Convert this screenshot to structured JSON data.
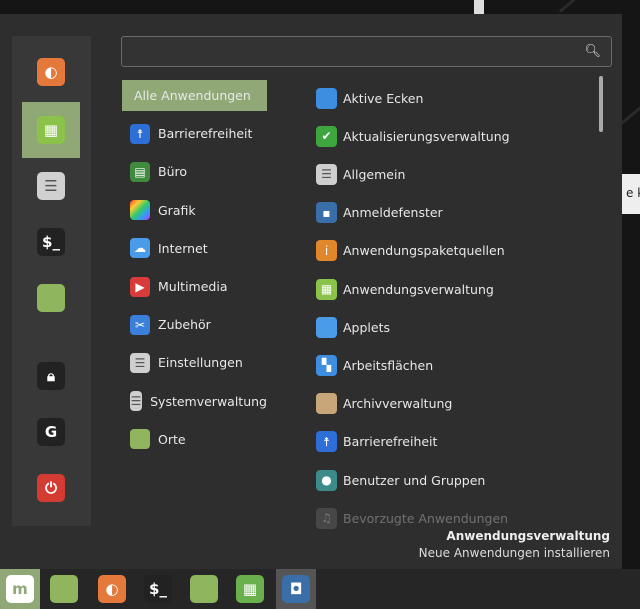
{
  "search": {
    "placeholder": "",
    "value": ""
  },
  "desktop_popup_text": "e ko",
  "sidebar": [
    {
      "name": "firefox",
      "icon": "firefox-icon",
      "color": "#e5793b"
    },
    {
      "name": "software-manager",
      "icon": "mint-install-icon",
      "color": "#8bc34a",
      "selected": true
    },
    {
      "name": "settings",
      "icon": "toggle-settings-icon",
      "color": "#d0d0d0"
    },
    {
      "name": "terminal",
      "icon": "terminal-icon",
      "color": "#222222"
    },
    {
      "name": "files",
      "icon": "folder-icon",
      "color": "#8fb55e"
    },
    {
      "name": "lock",
      "icon": "lock-icon",
      "color": "#222222"
    },
    {
      "name": "logout",
      "icon": "logout-icon",
      "color": "#222222"
    },
    {
      "name": "shutdown",
      "icon": "power-icon",
      "color": "#d43c33"
    }
  ],
  "categories": [
    {
      "label": "Alle Anwendungen",
      "selected": true
    },
    {
      "label": "Barrierefreiheit",
      "icon": "accessibility-icon",
      "color": "#2d6fd6"
    },
    {
      "label": "Büro",
      "icon": "office-icon",
      "color": "#3f8a3f"
    },
    {
      "label": "Grafik",
      "icon": "graphics-icon",
      "color": "#c94bd0"
    },
    {
      "label": "Internet",
      "icon": "cloud-icon",
      "color": "#4a9be8"
    },
    {
      "label": "Multimedia",
      "icon": "play-icon",
      "color": "#d93a3a"
    },
    {
      "label": "Zubehör",
      "icon": "scissors-icon",
      "color": "#3a7fd9"
    },
    {
      "label": "Einstellungen",
      "icon": "settings-icon",
      "color": "#cfcfcf"
    },
    {
      "label": "Systemverwaltung",
      "icon": "system-icon",
      "color": "#cfcfcf"
    },
    {
      "label": "Orte",
      "icon": "folder-icon",
      "color": "#8fb55e"
    }
  ],
  "apps": [
    {
      "label": "Aktive Ecken",
      "icon": "hot-corners-icon",
      "color": "#3d8ee0"
    },
    {
      "label": "Aktualisierungsverwaltung",
      "icon": "shield-icon",
      "color": "#3fa63f"
    },
    {
      "label": "Allgemein",
      "icon": "toggle-icon",
      "color": "#cfcfcf"
    },
    {
      "label": "Anmeldefenster",
      "icon": "login-window-icon",
      "color": "#3a6ea8"
    },
    {
      "label": "Anwendungspaketquellen",
      "icon": "info-icon",
      "color": "#e0862b"
    },
    {
      "label": "Anwendungsverwaltung",
      "icon": "mint-install-icon",
      "color": "#8bc34a"
    },
    {
      "label": "Applets",
      "icon": "applets-icon",
      "color": "#4a9be8"
    },
    {
      "label": "Arbeitsflächen",
      "icon": "workspaces-icon",
      "color": "#3d8ee0"
    },
    {
      "label": "Archivverwaltung",
      "icon": "archive-icon",
      "color": "#c9a67a"
    },
    {
      "label": "Barrierefreiheit",
      "icon": "accessibility-icon",
      "color": "#2d6fd6"
    },
    {
      "label": "Benutzer und Gruppen",
      "icon": "users-icon",
      "color": "#3d8a8a"
    },
    {
      "label": "Bevorzugte Anwendungen",
      "icon": "preferred-apps-icon",
      "color": "#777777",
      "faded": true
    }
  ],
  "description": {
    "title": "Anwendungsverwaltung",
    "subtitle": "Neue Anwendungen installieren"
  },
  "taskbar": [
    {
      "name": "menu",
      "icon": "mint-logo-icon",
      "color": "#8fa876",
      "active": true
    },
    {
      "name": "show-desktop",
      "icon": "desktop-icon",
      "color": "#8fb55e"
    },
    {
      "name": "firefox",
      "icon": "firefox-icon",
      "color": "#e5793b"
    },
    {
      "name": "terminal",
      "icon": "terminal-icon",
      "color": "#222222"
    },
    {
      "name": "files",
      "icon": "folder-icon",
      "color": "#8fb55e"
    },
    {
      "name": "software-manager",
      "icon": "mint-install-icon",
      "color": "#6ab04c"
    },
    {
      "name": "screenshot",
      "icon": "camera-icon",
      "color": "#3a6ea8",
      "current": true
    }
  ]
}
